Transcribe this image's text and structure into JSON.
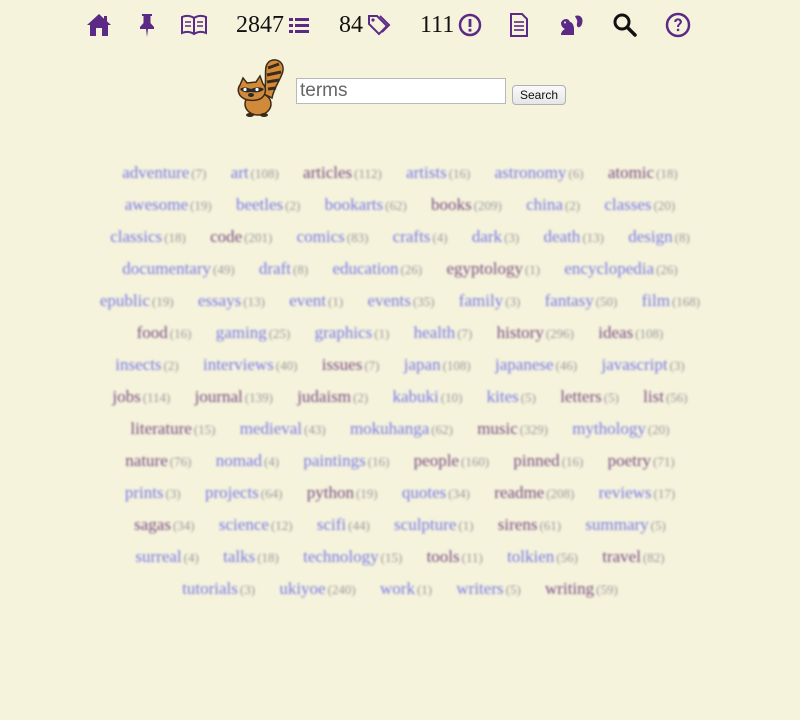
{
  "nav": {
    "stats": {
      "items": "2847",
      "tags": "84",
      "alerts": "111"
    }
  },
  "search": {
    "placeholder": "terms",
    "value": "terms",
    "button_label": "Search"
  },
  "tags": [
    {
      "name": "adventure",
      "count": "(7)",
      "visited": false
    },
    {
      "name": "art",
      "count": "(108)",
      "visited": false
    },
    {
      "name": "articles",
      "count": "(112)",
      "visited": true
    },
    {
      "name": "artists",
      "count": "(16)",
      "visited": false
    },
    {
      "name": "astronomy",
      "count": "(6)",
      "visited": false
    },
    {
      "name": "atomic",
      "count": "(18)",
      "visited": true
    },
    {
      "name": "awesome",
      "count": "(19)",
      "visited": false
    },
    {
      "name": "beetles",
      "count": "(2)",
      "visited": false
    },
    {
      "name": "bookarts",
      "count": "(62)",
      "visited": false
    },
    {
      "name": "books",
      "count": "(209)",
      "visited": true
    },
    {
      "name": "china",
      "count": "(2)",
      "visited": false
    },
    {
      "name": "classes",
      "count": "(20)",
      "visited": false
    },
    {
      "name": "classics",
      "count": "(18)",
      "visited": false
    },
    {
      "name": "code",
      "count": "(201)",
      "visited": true
    },
    {
      "name": "comics",
      "count": "(83)",
      "visited": false
    },
    {
      "name": "crafts",
      "count": "(4)",
      "visited": false
    },
    {
      "name": "dark",
      "count": "(3)",
      "visited": false
    },
    {
      "name": "death",
      "count": "(13)",
      "visited": false
    },
    {
      "name": "design",
      "count": "(8)",
      "visited": false
    },
    {
      "name": "documentary",
      "count": "(49)",
      "visited": false
    },
    {
      "name": "draft",
      "count": "(8)",
      "visited": false
    },
    {
      "name": "education",
      "count": "(26)",
      "visited": false
    },
    {
      "name": "egyptology",
      "count": "(1)",
      "visited": true
    },
    {
      "name": "encyclopedia",
      "count": "(26)",
      "visited": false
    },
    {
      "name": "epublic",
      "count": "(19)",
      "visited": false
    },
    {
      "name": "essays",
      "count": "(13)",
      "visited": false
    },
    {
      "name": "event",
      "count": "(1)",
      "visited": false
    },
    {
      "name": "events",
      "count": "(35)",
      "visited": false
    },
    {
      "name": "family",
      "count": "(3)",
      "visited": false
    },
    {
      "name": "fantasy",
      "count": "(50)",
      "visited": false
    },
    {
      "name": "film",
      "count": "(168)",
      "visited": false
    },
    {
      "name": "food",
      "count": "(16)",
      "visited": true
    },
    {
      "name": "gaming",
      "count": "(25)",
      "visited": false
    },
    {
      "name": "graphics",
      "count": "(1)",
      "visited": false
    },
    {
      "name": "health",
      "count": "(7)",
      "visited": false
    },
    {
      "name": "history",
      "count": "(296)",
      "visited": true
    },
    {
      "name": "ideas",
      "count": "(108)",
      "visited": true
    },
    {
      "name": "insects",
      "count": "(2)",
      "visited": false
    },
    {
      "name": "interviews",
      "count": "(40)",
      "visited": false
    },
    {
      "name": "issues",
      "count": "(7)",
      "visited": true
    },
    {
      "name": "japan",
      "count": "(108)",
      "visited": false
    },
    {
      "name": "japanese",
      "count": "(46)",
      "visited": false
    },
    {
      "name": "javascript",
      "count": "(3)",
      "visited": false
    },
    {
      "name": "jobs",
      "count": "(114)",
      "visited": true
    },
    {
      "name": "journal",
      "count": "(139)",
      "visited": true
    },
    {
      "name": "judaism",
      "count": "(2)",
      "visited": true
    },
    {
      "name": "kabuki",
      "count": "(10)",
      "visited": false
    },
    {
      "name": "kites",
      "count": "(5)",
      "visited": false
    },
    {
      "name": "letters",
      "count": "(5)",
      "visited": true
    },
    {
      "name": "list",
      "count": "(56)",
      "visited": true
    },
    {
      "name": "literature",
      "count": "(15)",
      "visited": true
    },
    {
      "name": "medieval",
      "count": "(43)",
      "visited": false
    },
    {
      "name": "mokuhanga",
      "count": "(62)",
      "visited": false
    },
    {
      "name": "music",
      "count": "(329)",
      "visited": true
    },
    {
      "name": "mythology",
      "count": "(20)",
      "visited": false
    },
    {
      "name": "nature",
      "count": "(76)",
      "visited": true
    },
    {
      "name": "nomad",
      "count": "(4)",
      "visited": false
    },
    {
      "name": "paintings",
      "count": "(16)",
      "visited": false
    },
    {
      "name": "people",
      "count": "(160)",
      "visited": true
    },
    {
      "name": "pinned",
      "count": "(16)",
      "visited": true
    },
    {
      "name": "poetry",
      "count": "(71)",
      "visited": true
    },
    {
      "name": "prints",
      "count": "(3)",
      "visited": false
    },
    {
      "name": "projects",
      "count": "(64)",
      "visited": false
    },
    {
      "name": "python",
      "count": "(19)",
      "visited": true
    },
    {
      "name": "quotes",
      "count": "(34)",
      "visited": false
    },
    {
      "name": "readme",
      "count": "(208)",
      "visited": true
    },
    {
      "name": "reviews",
      "count": "(17)",
      "visited": false
    },
    {
      "name": "sagas",
      "count": "(34)",
      "visited": true
    },
    {
      "name": "science",
      "count": "(12)",
      "visited": false
    },
    {
      "name": "scifi",
      "count": "(44)",
      "visited": false
    },
    {
      "name": "sculpture",
      "count": "(1)",
      "visited": false
    },
    {
      "name": "sirens",
      "count": "(61)",
      "visited": true
    },
    {
      "name": "summary",
      "count": "(5)",
      "visited": false
    },
    {
      "name": "surreal",
      "count": "(4)",
      "visited": false
    },
    {
      "name": "talks",
      "count": "(18)",
      "visited": false
    },
    {
      "name": "technology",
      "count": "(15)",
      "visited": false
    },
    {
      "name": "tools",
      "count": "(11)",
      "visited": true
    },
    {
      "name": "tolkien",
      "count": "(56)",
      "visited": false
    },
    {
      "name": "travel",
      "count": "(82)",
      "visited": true
    },
    {
      "name": "tutorials",
      "count": "(3)",
      "visited": false
    },
    {
      "name": "ukiyoe",
      "count": "(240)",
      "visited": false
    },
    {
      "name": "work",
      "count": "(1)",
      "visited": false
    },
    {
      "name": "writers",
      "count": "(5)",
      "visited": false
    },
    {
      "name": "writing",
      "count": "(59)",
      "visited": true
    }
  ],
  "colors": {
    "accent": "#5b2a86",
    "background": "#f5f3dc",
    "link": "#7a7ae6",
    "link_visited": "#7a4d82"
  }
}
